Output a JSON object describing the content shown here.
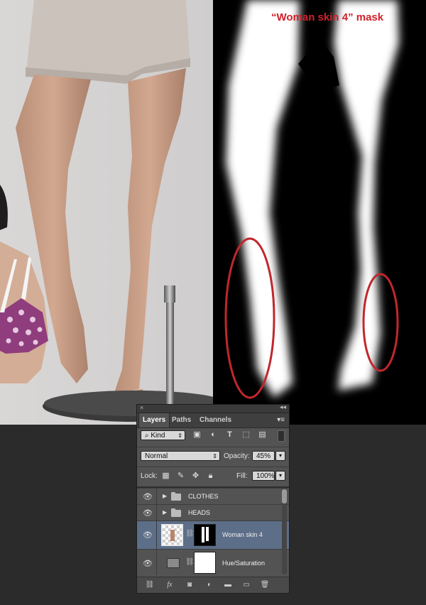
{
  "annotation": {
    "mask_title": "“Woman skin 4” mask"
  },
  "panel": {
    "close_glyph": "×",
    "collapse_glyph": "◂◂",
    "tabs": [
      {
        "label": "Layers",
        "active": true
      },
      {
        "label": "Paths",
        "active": false
      },
      {
        "label": "Channels",
        "active": false
      }
    ],
    "filter": {
      "kind_label": "Kind"
    },
    "blend_mode": "Normal",
    "opacity": {
      "label": "Opacity:",
      "value": "45%"
    },
    "lock": {
      "label": "Lock:"
    },
    "fill": {
      "label": "Fill:",
      "value": "100%"
    },
    "layers": [
      {
        "name": "CLOTHES",
        "type": "group",
        "visible": true,
        "selected": false
      },
      {
        "name": "HEADS",
        "type": "group",
        "visible": true,
        "selected": false
      },
      {
        "name": "Woman skin 4",
        "type": "layer-with-mask",
        "visible": true,
        "selected": true
      },
      {
        "name": "Hue/Saturation",
        "type": "adjustment",
        "visible": true,
        "selected": false
      }
    ],
    "bottom_icons": [
      "link-icon",
      "fx-icon",
      "add-mask-icon",
      "adjustment-icon",
      "new-group-icon",
      "new-layer-icon",
      "trash-icon"
    ],
    "bottom_labels": {
      "fx": "fx"
    }
  },
  "colors": {
    "annotation_red": "#d0212b",
    "selected_layer": "#5d6e89",
    "panel_bg": "#535353"
  }
}
